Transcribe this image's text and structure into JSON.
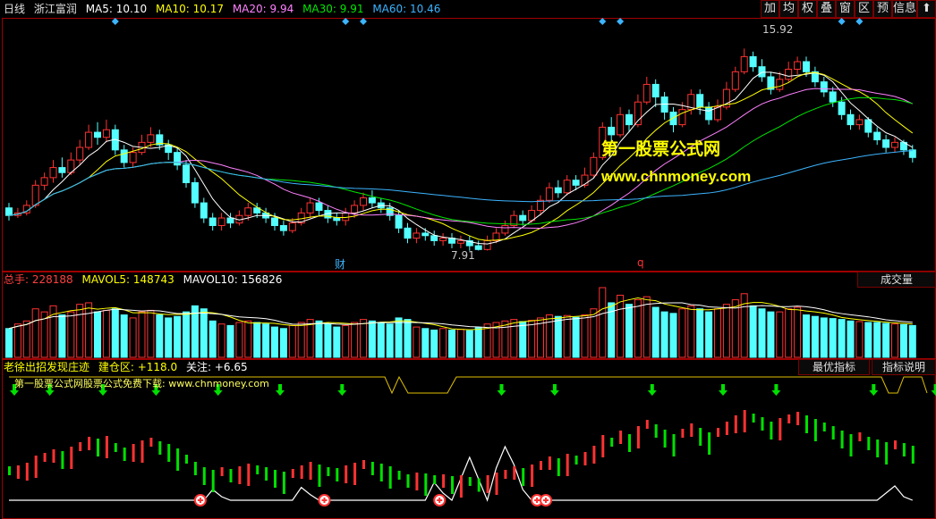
{
  "main_header": {
    "period": "日线",
    "stock_name": "浙江富润",
    "ma5": "MA5: 10.10",
    "ma10": "MA10: 10.17",
    "ma20": "MA20: 9.94",
    "ma30": "MA30: 9.91",
    "ma60": "MA60: 10.46"
  },
  "toolbar": [
    "加",
    "均",
    "权",
    "叠",
    "窗",
    "区",
    "预",
    "信息"
  ],
  "close_glyph": "⬆",
  "main_chart": {
    "high_label": "15.92",
    "low_label": "7.91",
    "cai_marker": "财",
    "q_marker": "q"
  },
  "watermark": {
    "title": "第一股票公式网",
    "url": "www.chnmoney.com"
  },
  "volume_header": {
    "total": "总手: 228188",
    "mavol5": "MAVOL5: 148743",
    "mavol10": "MAVOL10: 156826"
  },
  "volume_tab": "成交量",
  "indicator_header": {
    "name": "老徐出招发现庄迹",
    "jiancang": "建仓区: +118.0",
    "guanzhu": "关注: +6.65"
  },
  "indicator_tabs": {
    "best": "最优指标",
    "help": "指标说明"
  },
  "indicator_caption": "第一股票公式网股票公式免费下载: www.chnmoney.com",
  "colors": {
    "up": "#ff3232",
    "down": "#54ffff",
    "ma5": "#ffffff",
    "ma10": "#ffff00",
    "ma20": "#ff80ff",
    "ma30": "#00e600",
    "ma60": "#3cb4ff",
    "frame": "#a00000",
    "indicator_line": "#ffffff",
    "arrow": "#00e000"
  },
  "chart_data": {
    "type": "candlestick",
    "candles": [
      [
        9.6,
        9.3,
        9.8,
        9.1
      ],
      [
        9.3,
        9.4,
        9.6,
        9.2
      ],
      [
        9.4,
        9.7,
        9.9,
        9.3
      ],
      [
        9.7,
        10.5,
        10.7,
        9.6
      ],
      [
        10.5,
        10.8,
        11.0,
        10.3
      ],
      [
        10.8,
        11.2,
        11.5,
        10.6
      ],
      [
        11.2,
        11.0,
        11.6,
        10.8
      ],
      [
        11.0,
        11.5,
        11.8,
        10.9
      ],
      [
        11.5,
        12.0,
        12.3,
        11.3
      ],
      [
        12.0,
        12.6,
        12.9,
        11.9
      ],
      [
        12.6,
        12.4,
        13.0,
        12.1
      ],
      [
        12.4,
        12.7,
        13.1,
        12.2
      ],
      [
        12.7,
        11.9,
        12.9,
        11.7
      ],
      [
        11.9,
        11.4,
        12.1,
        11.2
      ],
      [
        11.4,
        11.8,
        12.0,
        11.2
      ],
      [
        11.8,
        12.2,
        12.5,
        11.7
      ],
      [
        12.2,
        12.5,
        12.8,
        12.0
      ],
      [
        12.5,
        12.1,
        12.7,
        11.9
      ],
      [
        12.1,
        11.8,
        12.3,
        11.5
      ],
      [
        11.8,
        11.3,
        12.0,
        11.1
      ],
      [
        11.3,
        10.6,
        11.5,
        10.4
      ],
      [
        10.6,
        9.8,
        10.8,
        9.6
      ],
      [
        9.8,
        9.2,
        10.0,
        9.0
      ],
      [
        9.2,
        8.9,
        9.4,
        8.7
      ],
      [
        8.9,
        9.2,
        9.4,
        8.7
      ],
      [
        9.2,
        9.0,
        9.4,
        8.8
      ],
      [
        9.0,
        9.3,
        9.5,
        8.9
      ],
      [
        9.3,
        9.6,
        9.8,
        9.1
      ],
      [
        9.6,
        9.4,
        9.8,
        9.2
      ],
      [
        9.4,
        9.2,
        9.6,
        9.0
      ],
      [
        9.2,
        8.9,
        9.4,
        8.7
      ],
      [
        8.9,
        8.7,
        9.1,
        8.5
      ],
      [
        8.7,
        9.0,
        9.2,
        8.6
      ],
      [
        9.0,
        9.4,
        9.6,
        8.9
      ],
      [
        9.4,
        9.8,
        10.0,
        9.2
      ],
      [
        9.8,
        9.5,
        10.0,
        9.3
      ],
      [
        9.5,
        9.2,
        9.7,
        9.0
      ],
      [
        9.2,
        9.1,
        9.4,
        8.9
      ],
      [
        9.1,
        9.4,
        9.6,
        8.9
      ],
      [
        9.4,
        9.7,
        9.9,
        9.2
      ],
      [
        9.7,
        10.0,
        10.2,
        9.5
      ],
      [
        10.0,
        9.8,
        10.3,
        9.6
      ],
      [
        9.8,
        9.6,
        10.0,
        9.4
      ],
      [
        9.6,
        9.3,
        9.8,
        9.1
      ],
      [
        9.3,
        8.8,
        9.5,
        8.6
      ],
      [
        8.8,
        8.4,
        9.0,
        8.2
      ],
      [
        8.4,
        8.6,
        8.8,
        8.2
      ],
      [
        8.6,
        8.5,
        8.8,
        8.3
      ],
      [
        8.5,
        8.3,
        8.7,
        8.1
      ],
      [
        8.3,
        8.4,
        8.6,
        8.1
      ],
      [
        8.4,
        8.2,
        8.6,
        8.0
      ],
      [
        8.2,
        8.3,
        8.5,
        8.0
      ],
      [
        8.3,
        8.1,
        8.5,
        7.9
      ],
      [
        8.1,
        7.95,
        8.3,
        7.91
      ],
      [
        7.95,
        8.3,
        8.5,
        7.91
      ],
      [
        8.3,
        8.6,
        8.8,
        8.2
      ],
      [
        8.6,
        8.9,
        9.1,
        8.5
      ],
      [
        8.9,
        9.3,
        9.5,
        8.8
      ],
      [
        9.3,
        9.1,
        9.5,
        8.9
      ],
      [
        9.1,
        9.5,
        9.7,
        9.0
      ],
      [
        9.5,
        9.9,
        10.1,
        9.3
      ],
      [
        9.9,
        10.4,
        10.6,
        9.8
      ],
      [
        10.4,
        10.2,
        10.7,
        10.0
      ],
      [
        10.2,
        10.7,
        10.9,
        10.1
      ],
      [
        10.7,
        10.5,
        10.9,
        10.3
      ],
      [
        10.5,
        10.9,
        11.2,
        10.4
      ],
      [
        10.9,
        11.6,
        11.8,
        10.8
      ],
      [
        11.6,
        12.8,
        13.0,
        11.5
      ],
      [
        12.8,
        12.5,
        13.2,
        12.2
      ],
      [
        12.5,
        13.3,
        13.6,
        12.4
      ],
      [
        13.3,
        12.9,
        13.5,
        12.6
      ],
      [
        12.9,
        13.8,
        14.1,
        12.8
      ],
      [
        13.8,
        14.5,
        14.8,
        13.7
      ],
      [
        14.5,
        14.0,
        14.7,
        13.6
      ],
      [
        14.0,
        13.4,
        14.2,
        13.1
      ],
      [
        13.4,
        12.9,
        13.6,
        12.6
      ],
      [
        12.9,
        13.5,
        13.8,
        12.8
      ],
      [
        13.5,
        14.1,
        14.3,
        13.3
      ],
      [
        14.1,
        13.6,
        14.3,
        13.3
      ],
      [
        13.6,
        13.1,
        13.8,
        12.9
      ],
      [
        13.1,
        13.6,
        13.9,
        13.0
      ],
      [
        13.6,
        14.3,
        14.6,
        13.5
      ],
      [
        14.3,
        15.0,
        15.2,
        14.2
      ],
      [
        15.0,
        15.6,
        15.92,
        14.9
      ],
      [
        15.6,
        15.2,
        15.8,
        15.0
      ],
      [
        15.2,
        14.8,
        15.5,
        14.6
      ],
      [
        14.8,
        14.3,
        15.0,
        14.1
      ],
      [
        14.3,
        14.7,
        15.0,
        14.2
      ],
      [
        14.7,
        15.1,
        15.4,
        14.6
      ],
      [
        15.1,
        15.4,
        15.6,
        14.9
      ],
      [
        15.4,
        15.0,
        15.6,
        14.8
      ],
      [
        15.0,
        14.6,
        15.2,
        14.4
      ],
      [
        14.6,
        14.2,
        14.8,
        14.0
      ],
      [
        14.2,
        13.8,
        14.4,
        13.6
      ],
      [
        13.8,
        13.3,
        14.0,
        13.1
      ],
      [
        13.3,
        12.9,
        13.5,
        12.7
      ],
      [
        12.9,
        13.1,
        13.3,
        12.7
      ],
      [
        13.1,
        12.6,
        13.2,
        12.4
      ],
      [
        12.6,
        12.3,
        12.8,
        12.1
      ],
      [
        12.3,
        12.0,
        12.5,
        11.8
      ],
      [
        12.0,
        12.2,
        12.4,
        11.8
      ],
      [
        12.2,
        11.9,
        12.3,
        11.7
      ],
      [
        11.9,
        11.6,
        12.1,
        11.4
      ]
    ],
    "volume": [
      95,
      110,
      120,
      160,
      150,
      170,
      140,
      150,
      175,
      180,
      150,
      155,
      160,
      140,
      130,
      150,
      155,
      140,
      130,
      135,
      150,
      170,
      160,
      120,
      110,
      105,
      115,
      120,
      115,
      110,
      100,
      95,
      105,
      115,
      125,
      120,
      110,
      100,
      105,
      115,
      125,
      120,
      115,
      110,
      130,
      125,
      100,
      95,
      90,
      95,
      90,
      92,
      88,
      98,
      110,
      115,
      120,
      125,
      118,
      122,
      130,
      140,
      135,
      138,
      132,
      140,
      160,
      230,
      180,
      205,
      175,
      190,
      200,
      165,
      150,
      145,
      160,
      170,
      160,
      150,
      160,
      175,
      190,
      210,
      170,
      160,
      150,
      150,
      160,
      165,
      140,
      135,
      130,
      128,
      125,
      120,
      118,
      115,
      115,
      112,
      110,
      108,
      105
    ],
    "indicator_values": [
      0.0,
      0.0,
      0.0,
      0.0,
      0.0,
      0.0,
      0.0,
      0.0,
      0.0,
      0.0,
      0.0,
      0.0,
      0.0,
      0.0,
      0.0,
      0.0,
      0.0,
      0.0,
      0.0,
      0.0,
      0.0,
      0.0,
      0.0,
      0.15,
      0.05,
      0.0,
      0.0,
      0.0,
      0.0,
      0.0,
      0.0,
      0.0,
      0.0,
      0.18,
      0.08,
      0.0,
      0.0,
      0.0,
      0.0,
      0.0,
      0.0,
      0.0,
      0.0,
      0.0,
      0.0,
      0.0,
      0.0,
      0.0,
      0.25,
      0.1,
      0.0,
      0.3,
      0.6,
      0.3,
      0.0,
      0.45,
      0.75,
      0.5,
      0.15,
      0.0,
      0.0,
      0.0,
      0.0,
      0.0,
      0.0,
      0.0,
      0.0,
      0.0,
      0.0,
      0.0,
      0.0,
      0.0,
      0.0,
      0.0,
      0.0,
      0.0,
      0.0,
      0.0,
      0.0,
      0.0,
      0.0,
      0.0,
      0.0,
      0.0,
      0.0,
      0.0,
      0.0,
      0.0,
      0.0,
      0.0,
      0.0,
      0.0,
      0.0,
      0.0,
      0.0,
      0.0,
      0.0,
      0.0,
      0.0,
      0.1,
      0.2,
      0.05,
      0.0
    ],
    "buy_markers": [
      21,
      35,
      48,
      59,
      60,
      114
    ],
    "top_arrows": [
      0,
      4,
      10,
      16,
      23,
      30,
      37,
      55,
      61,
      72,
      80,
      86,
      97,
      104,
      113
    ],
    "price_range": [
      7.5,
      16.5
    ]
  }
}
